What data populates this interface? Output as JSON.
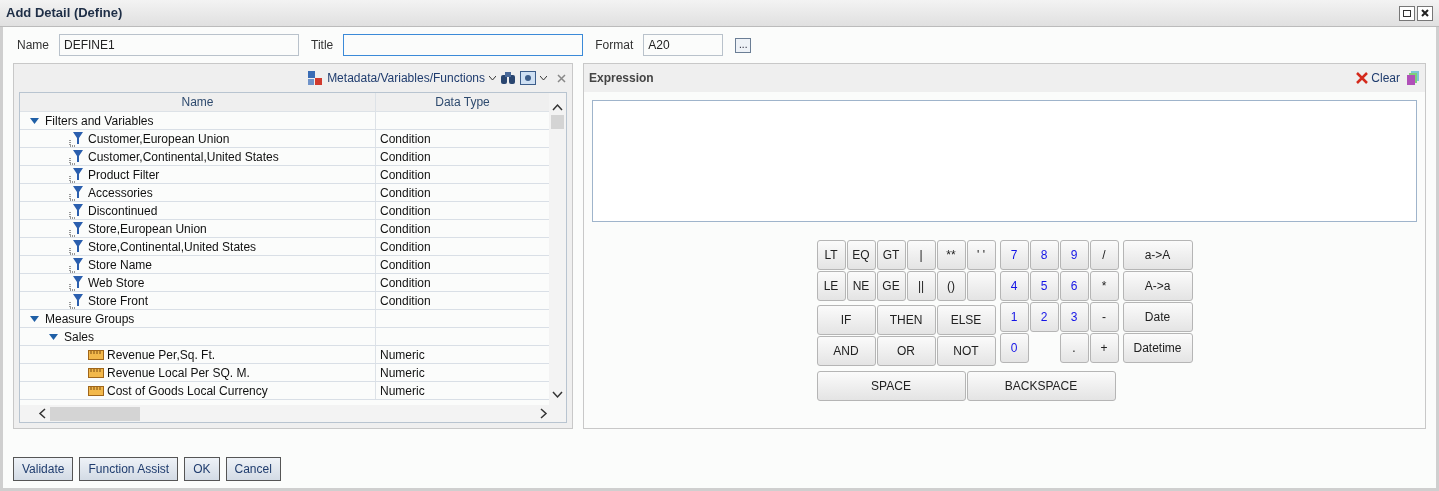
{
  "window": {
    "title": "Add Detail (Define)"
  },
  "fields": [
    {
      "label": "Name",
      "value": "DEFINE1",
      "focused": false
    },
    {
      "label": "Title",
      "focused": true
    },
    {
      "label": "Format",
      "value": "A20",
      "focused": false
    }
  ],
  "format_button": {
    "label": "..."
  },
  "metadata_panel": {
    "menu_label": "Metadata/Variables/Functions",
    "table": {
      "columns": [
        "Name",
        "Data Type"
      ],
      "rows": [
        {
          "name": "Filters and Variables",
          "kind": "group",
          "expanded": true,
          "children": [
            {
              "name": "Customer,European Union",
              "type": "Condition",
              "kind": "filter"
            },
            {
              "name": "Customer,Continental,United States",
              "type": "Condition",
              "kind": "filter"
            },
            {
              "name": "Product Filter",
              "type": "Condition",
              "kind": "filter"
            },
            {
              "name": "Accessories",
              "type": "Condition",
              "kind": "filter"
            },
            {
              "name": "Discontinued",
              "type": "Condition",
              "kind": "filter"
            },
            {
              "name": "Store,European Union",
              "type": "Condition",
              "kind": "filter"
            },
            {
              "name": "Store,Continental,United States",
              "type": "Condition",
              "kind": "filter"
            },
            {
              "name": "Store Name",
              "type": "Condition",
              "kind": "filter"
            },
            {
              "name": "Web Store",
              "type": "Condition",
              "kind": "filter"
            },
            {
              "name": "Store Front",
              "type": "Condition",
              "kind": "filter"
            }
          ]
        },
        {
          "name": "Measure Groups",
          "kind": "group",
          "expanded": true,
          "children": [
            {
              "name": "Sales",
              "kind": "group",
              "expanded": true,
              "children": [
                {
                  "name": "Revenue Per,Sq. Ft.",
                  "type": "Numeric",
                  "kind": "measure"
                },
                {
                  "name": "Revenue Local Per SQ. M.",
                  "type": "Numeric",
                  "kind": "measure"
                },
                {
                  "name": "Cost of Goods Local Currency",
                  "type": "Numeric",
                  "kind": "measure"
                }
              ]
            }
          ]
        }
      ]
    }
  },
  "expression_panel": {
    "title": "Expression",
    "clear_label": "Clear"
  },
  "keypad": {
    "logic_keys": [
      [
        {
          "label": "LT"
        },
        {
          "label": "EQ"
        },
        {
          "label": "GT"
        },
        {
          "label": "|"
        },
        {
          "label": "**"
        },
        {
          "label": "' '"
        }
      ],
      [
        {
          "label": "LE"
        },
        {
          "label": "NE"
        },
        {
          "label": "GE"
        },
        {
          "label": "||"
        },
        {
          "label": "()"
        }
      ]
    ],
    "word_keys": [
      [
        "IF",
        "THEN",
        "ELSE"
      ],
      [
        "AND",
        "OR",
        "NOT"
      ]
    ],
    "number_keys": [
      [
        {
          "label": "7",
          "kind": "digit"
        },
        {
          "label": "8",
          "kind": "digit"
        },
        {
          "label": "9",
          "kind": "digit"
        },
        {
          "label": "/",
          "kind": "operator"
        }
      ],
      [
        {
          "label": "4",
          "kind": "digit"
        },
        {
          "label": "5",
          "kind": "digit"
        },
        {
          "label": "6",
          "kind": "digit"
        },
        {
          "label": "*",
          "kind": "operator"
        }
      ],
      [
        {
          "label": "1",
          "kind": "digit"
        },
        {
          "label": "2",
          "kind": "digit"
        },
        {
          "label": "3",
          "kind": "digit"
        },
        {
          "label": "-",
          "kind": "operator"
        }
      ],
      [
        {
          "label": "0",
          "kind": "digit"
        },
        {
          "kind": "gap"
        },
        {
          "label": ".",
          "kind": "operator"
        },
        {
          "label": "+",
          "kind": "operator"
        }
      ]
    ],
    "function_keys": [
      "a->A",
      "A->a",
      "Date",
      "Datetime"
    ],
    "wide_keys": [
      "SPACE",
      "BACKSPACE"
    ]
  },
  "footer_buttons": [
    "Validate",
    "Function Assist",
    "OK",
    "Cancel"
  ]
}
